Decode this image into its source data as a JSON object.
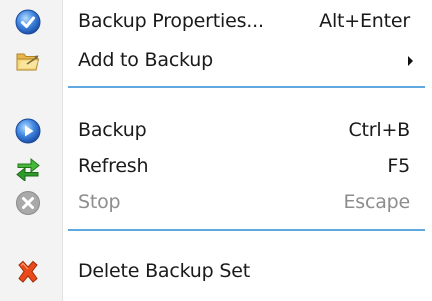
{
  "menu": {
    "items": [
      {
        "label": "Backup Properties...",
        "shortcut": "Alt+Enter",
        "icon": "properties-icon"
      },
      {
        "label": "Add to Backup",
        "shortcut": "",
        "icon": "folder-open-icon",
        "submenu": true
      },
      {
        "label": "Backup",
        "shortcut": "Ctrl+B",
        "icon": "backup-play-icon"
      },
      {
        "label": "Refresh",
        "shortcut": "F5",
        "icon": "refresh-icon"
      },
      {
        "label": "Stop",
        "shortcut": "Escape",
        "icon": "stop-icon",
        "disabled": true
      },
      {
        "label": "Delete Backup Set",
        "shortcut": "",
        "icon": "delete-icon"
      }
    ]
  },
  "colors": {
    "separator": "#5fa8e0",
    "disabled_text": "#8d8d8d",
    "gutter": "#f3f3f3"
  }
}
